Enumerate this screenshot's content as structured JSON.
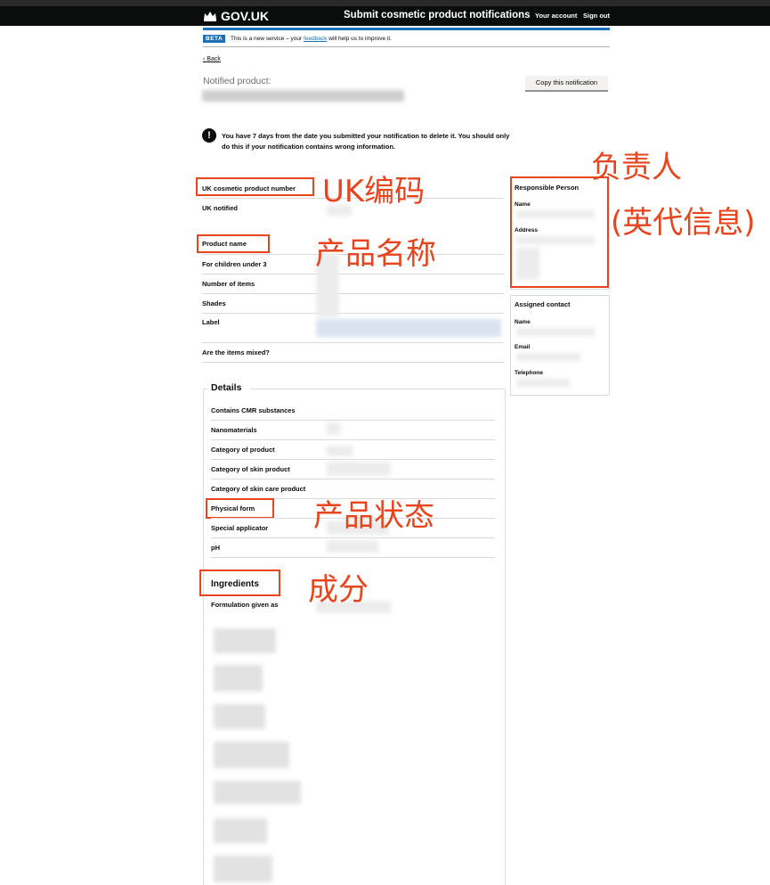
{
  "header": {
    "logo": "GOV.UK",
    "service_name": "Submit cosmetic product notifications",
    "your_account": "Your account",
    "sign_out": "Sign out"
  },
  "beta": {
    "tag": "BETA",
    "text_before": "This is a new service – your ",
    "feedback_link": "feedback",
    "text_after": " will help us to improve it."
  },
  "back_link": "Back",
  "notified_label": "Notified product:",
  "copy_button": "Copy this notification",
  "warning": {
    "icon": "!",
    "text": "You have 7 days from the date you submitted your notification to delete it. You should only do this if your notification contains wrong information."
  },
  "summary": {
    "uk_number": "UK cosmetic product number",
    "uk_notified": "UK notified",
    "product_name": "Product name",
    "children": "For children under 3",
    "items": "Number of items",
    "shades": "Shades",
    "label": "Label",
    "mixed": "Are the items mixed?"
  },
  "details": {
    "title": "Details",
    "cmr": "Contains CMR substances",
    "nano": "Nanomaterials",
    "category": "Category of product",
    "skin_category": "Category of skin product",
    "skin_care_category": "Category of skin care product",
    "physical_form": "Physical form",
    "applicator": "Special applicator",
    "ph": "pH",
    "ingredients_title": "Ingredients",
    "formulation": "Formulation given as"
  },
  "responsible_person": {
    "title": "Responsible Person",
    "name_label": "Name",
    "address_label": "Address"
  },
  "assigned_contact": {
    "title": "Assigned contact",
    "name_label": "Name",
    "email_label": "Email",
    "telephone_label": "Telephone"
  },
  "annotations": {
    "uk_code": "UK编码",
    "product_name": "产品名称",
    "responsible": "负责人",
    "responsible_sub": "(英代信息)",
    "physical_state": "产品状态",
    "ingredients": "成分"
  },
  "colors": {
    "annotation": "#e8441d",
    "govuk_blue": "#1d70b8",
    "header": "#0b0c0c"
  }
}
